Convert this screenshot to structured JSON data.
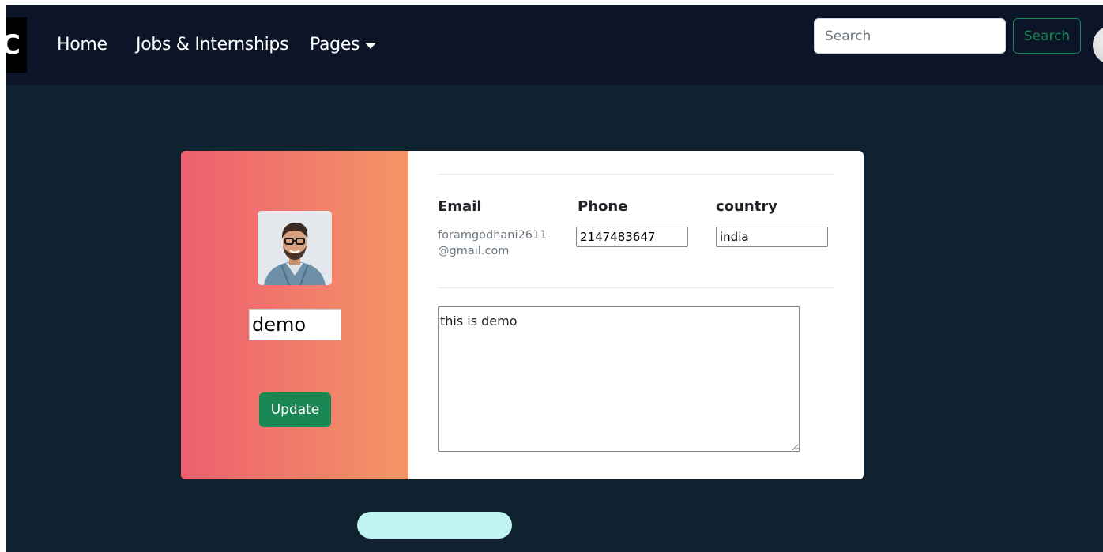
{
  "navbar": {
    "brand_letter": "C",
    "links": [
      "Home",
      "Jobs & Internships",
      "Pages"
    ],
    "search": {
      "placeholder": "Search",
      "value": ""
    },
    "search_button": "Search"
  },
  "profile": {
    "name_value": "demo",
    "update_button": "Update",
    "email_label": "Email",
    "email_value": "foramgodhani2611@gmail.com",
    "email_line1": "foramgodhani2611",
    "email_line2": "@gmail.com",
    "phone_label": "Phone",
    "phone_value": "2147483647",
    "country_label": "country",
    "country_value": "india",
    "about_value": "this is demo"
  },
  "colors": {
    "navbar_bg": "#0c1527",
    "page_bg": "#10212f",
    "gradient_start": "#ee5f70",
    "gradient_end": "#f49566",
    "success": "#198754",
    "pill": "#bff4f1"
  }
}
